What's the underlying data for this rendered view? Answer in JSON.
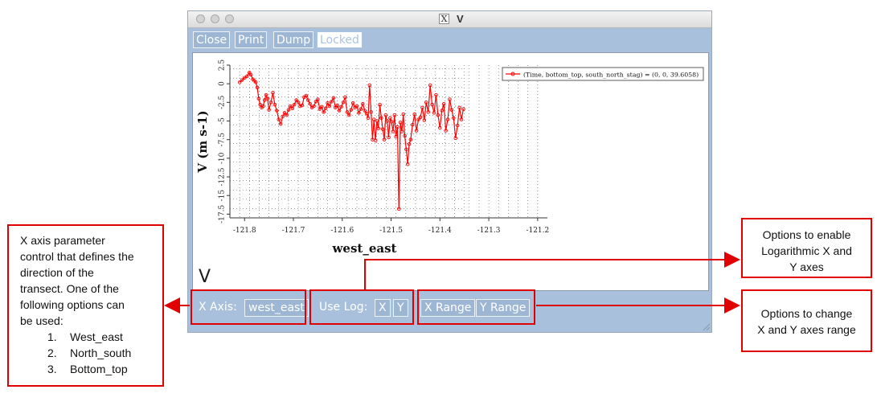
{
  "window": {
    "title": "V",
    "x_glyph": "X",
    "toolbar": {
      "close": "Close",
      "print": "Print",
      "dump": "Dump",
      "locked": "Locked"
    },
    "big_label": "V",
    "bottom": {
      "x_axis_label": "X Axis:",
      "x_axis_value": "west_east",
      "use_log_label": "Use Log:",
      "log_x": "X",
      "log_y": "Y",
      "x_range": "X Range",
      "y_range": "Y Range"
    }
  },
  "chart_data": {
    "type": "line",
    "xlabel": "west_east",
    "ylabel": "V (m s-1)",
    "xlim": [
      -121.83,
      -121.18
    ],
    "ylim": [
      -18,
      2.5
    ],
    "xticks": [
      "-121.8",
      "-121.7",
      "-121.6",
      "-121.5",
      "-121.4",
      "-121.3",
      "-121.2"
    ],
    "xtick_values": [
      -121.8,
      -121.7,
      -121.6,
      -121.5,
      -121.4,
      -121.3,
      -121.2
    ],
    "yticks": [
      "2.5",
      "0",
      "-2.5",
      "-5",
      "-7.5",
      "-10",
      "-12.5",
      "-15",
      "-17.5"
    ],
    "ytick_values": [
      2.5,
      0,
      -2.5,
      -5,
      -7.5,
      -10,
      -12.5,
      -15,
      -17.5
    ],
    "grid": true,
    "legend_position": "top-right",
    "series": [
      {
        "name": "(Time, bottom_top, south_north_stag) = (0, 0, 39.6058)",
        "color": "#ff0000",
        "x": [
          -121.81,
          -121.805,
          -121.8,
          -121.795,
          -121.79,
          -121.787,
          -121.783,
          -121.78,
          -121.777,
          -121.774,
          -121.771,
          -121.768,
          -121.765,
          -121.762,
          -121.759,
          -121.756,
          -121.753,
          -121.75,
          -121.746,
          -121.742,
          -121.738,
          -121.734,
          -121.73,
          -121.726,
          -121.722,
          -121.718,
          -121.714,
          -121.71,
          -121.706,
          -121.702,
          -121.698,
          -121.694,
          -121.69,
          -121.686,
          -121.682,
          -121.678,
          -121.674,
          -121.67,
          -121.666,
          -121.662,
          -121.658,
          -121.654,
          -121.65,
          -121.646,
          -121.642,
          -121.638,
          -121.634,
          -121.63,
          -121.626,
          -121.622,
          -121.618,
          -121.614,
          -121.61,
          -121.606,
          -121.602,
          -121.598,
          -121.594,
          -121.59,
          -121.586,
          -121.582,
          -121.578,
          -121.574,
          -121.57,
          -121.566,
          -121.562,
          -121.558,
          -121.554,
          -121.55,
          -121.547,
          -121.544,
          -121.541,
          -121.538,
          -121.535,
          -121.532,
          -121.529,
          -121.526,
          -121.523,
          -121.52,
          -121.517,
          -121.514,
          -121.511,
          -121.508,
          -121.505,
          -121.502,
          -121.499,
          -121.496,
          -121.493,
          -121.49,
          -121.487,
          -121.484,
          -121.481,
          -121.478,
          -121.475,
          -121.472,
          -121.469,
          -121.466,
          -121.463,
          -121.46,
          -121.456,
          -121.452,
          -121.448,
          -121.444,
          -121.44,
          -121.436,
          -121.432,
          -121.428,
          -121.424,
          -121.42,
          -121.416,
          -121.412,
          -121.408,
          -121.404,
          -121.4,
          -121.396,
          -121.392,
          -121.388,
          -121.384,
          -121.38,
          -121.376,
          -121.372,
          -121.368,
          -121.364,
          -121.36,
          -121.356,
          -121.352
        ],
        "y": [
          0.2,
          0.5,
          0.8,
          1.0,
          1.5,
          1.2,
          0.6,
          0.4,
          0.2,
          -0.5,
          -2.0,
          -2.8,
          -3.2,
          -3.0,
          -2.2,
          -1.5,
          -2.0,
          -3.5,
          -2.5,
          -1.2,
          -2.8,
          -3.6,
          -4.8,
          -5.4,
          -4.4,
          -3.9,
          -4.2,
          -3.5,
          -3.0,
          -3.3,
          -2.8,
          -2.2,
          -2.5,
          -3.0,
          -2.9,
          -1.8,
          -1.6,
          -2.2,
          -2.7,
          -3.2,
          -3.0,
          -2.4,
          -2.1,
          -3.4,
          -3.1,
          -3.8,
          -3.3,
          -2.6,
          -3.0,
          -2.4,
          -1.9,
          -3.2,
          -2.9,
          -3.6,
          -3.1,
          -2.5,
          -1.8,
          -3.8,
          -4.2,
          -3.5,
          -2.6,
          -3.2,
          -3.0,
          -3.9,
          -3.4,
          -2.7,
          -3.6,
          -4.0,
          -4.6,
          -0.2,
          -3.8,
          -7.5,
          -4.8,
          -7.6,
          -5.0,
          -6.0,
          -2.8,
          -4.6,
          -6.1,
          -7.5,
          -4.2,
          -5.0,
          -7.2,
          -4.6,
          -5.1,
          -6.4,
          -4.2,
          -7.1,
          -5.8,
          -16.8,
          -5.2,
          -6.4,
          -4.1,
          -7.0,
          -8.8,
          -10.8,
          -8.1,
          -7.5,
          -5.5,
          -4.1,
          -6.3,
          -4.8,
          -4.5,
          -3.2,
          -4.9,
          -2.5,
          -3.8,
          -0.2,
          -2.8,
          -3.9,
          -1.5,
          -4.2,
          -5.9,
          -3.6,
          -2.7,
          -6.3,
          -4.8,
          -2.1,
          -3.5,
          -4.6,
          -7.3,
          -5.6,
          -3.2,
          -4.8,
          -3.4
        ]
      }
    ]
  },
  "annotations": {
    "x_axis_box": {
      "lines": [
        "X axis parameter",
        "control that defines the",
        "direction of the",
        "transect. One of the",
        "following options can",
        "be used:"
      ],
      "options": [
        {
          "num": "1.",
          "label": "West_east"
        },
        {
          "num": "2.",
          "label": "North_south"
        },
        {
          "num": "3.",
          "label": "Bottom_top"
        }
      ]
    },
    "log_box": {
      "lines": [
        "Options to enable",
        "Logarithmic X and",
        "Y axes"
      ]
    },
    "range_box": {
      "lines": [
        "Options to change",
        "X and Y axes range"
      ]
    }
  }
}
